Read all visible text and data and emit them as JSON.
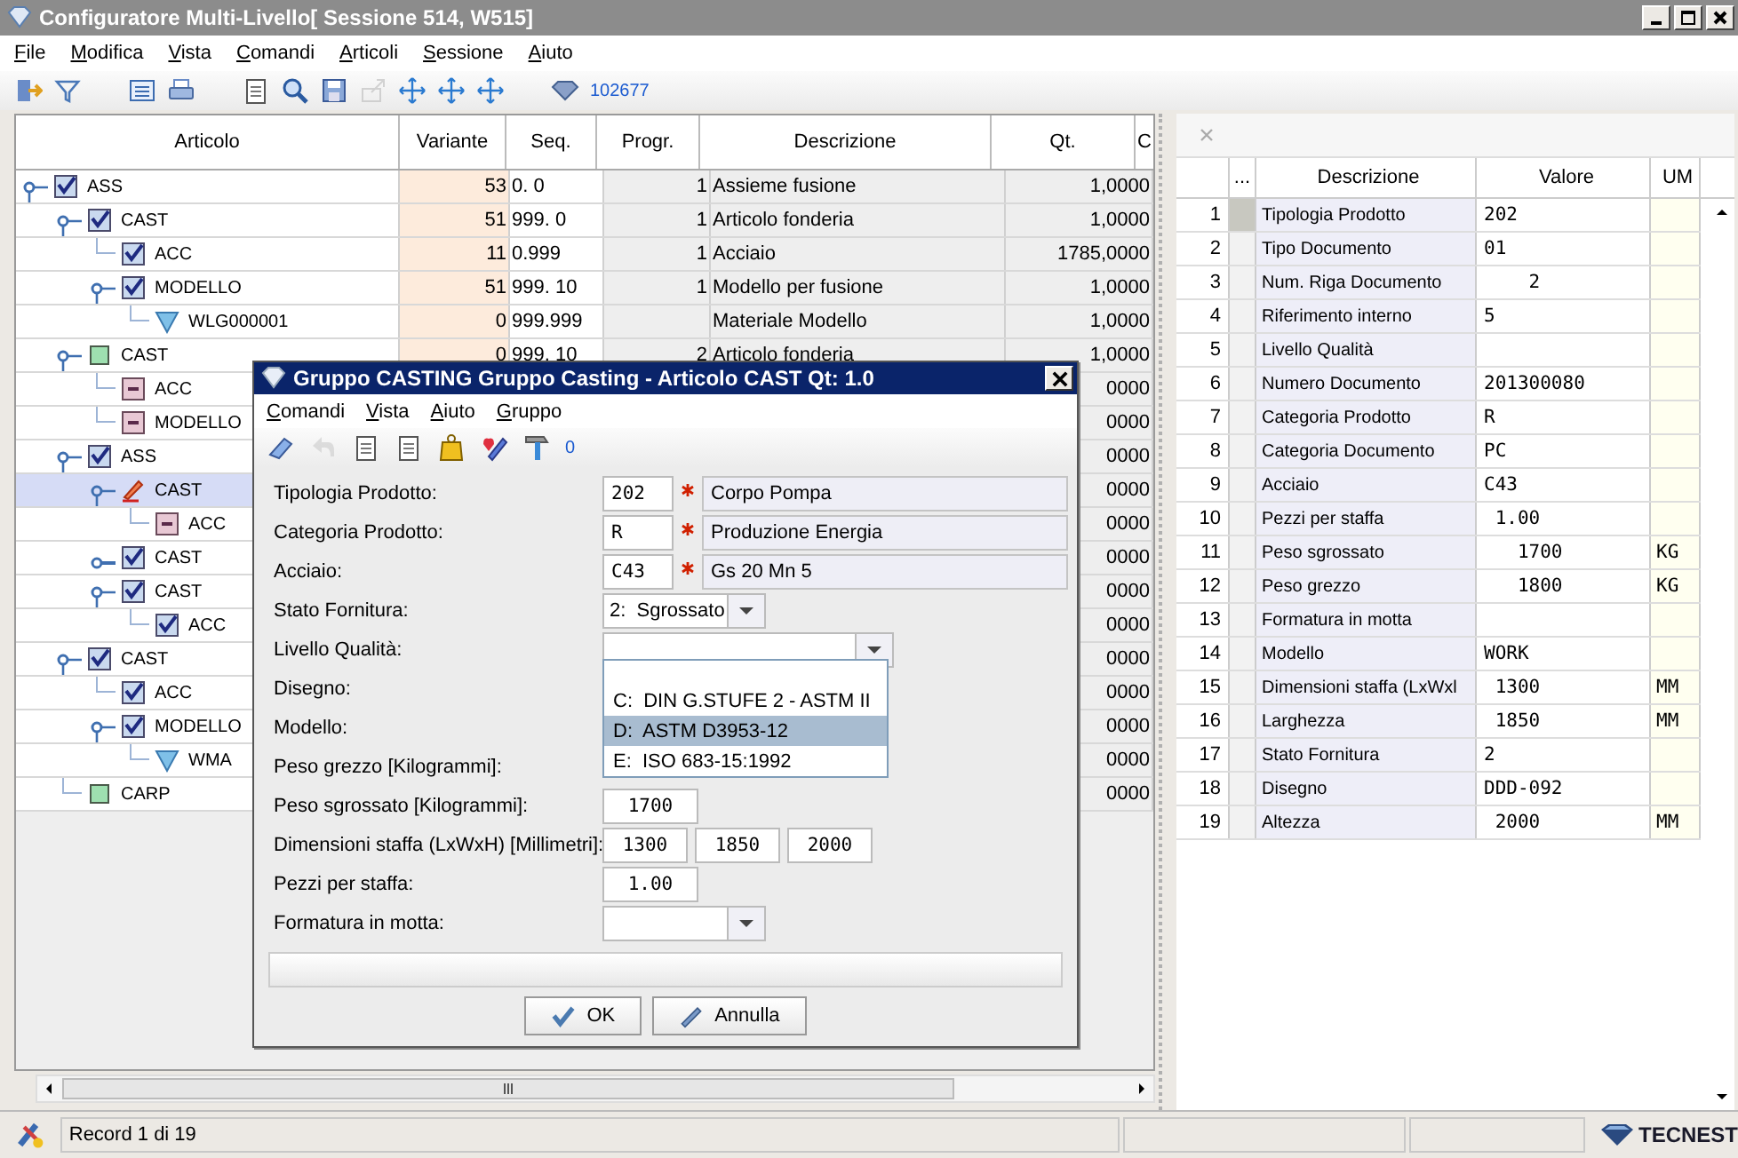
{
  "window": {
    "title": "Configuratore Multi-Livello[ Sessione 514, W515]"
  },
  "menu": [
    "File",
    "Modifica",
    "Vista",
    "Comandi",
    "Articoli",
    "Sessione",
    "Aiuto"
  ],
  "toolbar": {
    "counter": "102677"
  },
  "tree": {
    "columns": [
      "Articolo",
      "Variante",
      "Seq.",
      "Progr.",
      "Descrizione",
      "Qt.",
      "C"
    ],
    "rows": [
      {
        "label": "ASS",
        "kind": "check",
        "selected": false,
        "expanded": true,
        "variante": "53",
        "seq": "0. 0",
        "progr": "1",
        "descrizione": "Assieme fusione",
        "qt": "1,0000",
        "children": [
          {
            "label": "CAST",
            "kind": "check",
            "selected": false,
            "expanded": true,
            "variante": "51",
            "seq": "999. 0",
            "progr": "1",
            "descrizione": "Articolo fonderia",
            "qt": "1,0000",
            "children": [
              {
                "label": "ACC",
                "kind": "check",
                "selected": false,
                "variante": "11",
                "seq": "0.999",
                "progr": "1",
                "descrizione": "Acciaio",
                "qt": "1785,0000"
              },
              {
                "label": "MODELLO",
                "kind": "check",
                "selected": false,
                "expanded": true,
                "variante": "51",
                "seq": "999. 10",
                "progr": "1",
                "descrizione": "Modello per fusione",
                "qt": "1,0000",
                "children": [
                  {
                    "label": "WLG000001",
                    "kind": "material",
                    "selected": false,
                    "variante": "0",
                    "seq": "999.999",
                    "descrizione": "Materiale Modello",
                    "qt": "1,0000"
                  }
                ]
              }
            ]
          },
          {
            "label": "CAST",
            "kind": "square",
            "selected": false,
            "expanded": true,
            "variante": "0",
            "seq": "999. 10",
            "progr": "2",
            "descrizione": "Articolo fonderia",
            "qt": "1,0000",
            "children": [
              {
                "label": "ACC",
                "kind": "part",
                "selected": false,
                "qt": "0000"
              },
              {
                "label": "MODELLO",
                "kind": "part",
                "selected": false,
                "qt": "0000"
              }
            ]
          },
          {
            "label": "ASS",
            "kind": "check",
            "selected": false,
            "expanded": true,
            "qt": "0000",
            "children": [
              {
                "label": "CAST",
                "kind": "edit",
                "selected": true,
                "expanded": true,
                "qt": "0000",
                "children": [
                  {
                    "label": "ACC",
                    "kind": "part",
                    "selected": false,
                    "qt": "0000"
                  }
                ]
              },
              {
                "label": "CAST",
                "kind": "check",
                "selected": false,
                "expanded": false,
                "qt": "0000"
              },
              {
                "label": "CAST",
                "kind": "check",
                "selected": false,
                "expanded": true,
                "qt": "0000",
                "children": [
                  {
                    "label": "ACC",
                    "kind": "check",
                    "selected": false,
                    "qt": "0000"
                  }
                ]
              }
            ]
          },
          {
            "label": "CAST",
            "kind": "check",
            "selected": false,
            "expanded": true,
            "qt": "0000",
            "children": [
              {
                "label": "ACC",
                "kind": "check",
                "selected": false,
                "qt": "0000"
              },
              {
                "label": "MODELLO",
                "kind": "check",
                "selected": false,
                "expanded": true,
                "qt": "0000",
                "children": [
                  {
                    "label": "WMA",
                    "kind": "material",
                    "selected": false,
                    "qt": "0000"
                  }
                ]
              }
            ]
          },
          {
            "label": "CARP",
            "kind": "square",
            "selected": false,
            "qt": "0000"
          }
        ]
      }
    ]
  },
  "properties": {
    "columns": [
      "...",
      "Descrizione",
      "Valore",
      "UM"
    ],
    "rows": [
      {
        "n": "1",
        "descrizione": "Tipologia Prodotto",
        "valore": "202",
        "selected": true
      },
      {
        "n": "2",
        "descrizione": "Tipo Documento",
        "valore": "01",
        "selected": false
      },
      {
        "n": "3",
        "descrizione": "Num. Riga Documento",
        "valore": "    2",
        "selected": false
      },
      {
        "n": "4",
        "descrizione": "Riferimento interno",
        "valore": "5",
        "selected": false
      },
      {
        "n": "5",
        "descrizione": "Livello Qualità",
        "selected": false
      },
      {
        "n": "6",
        "descrizione": "Numero Documento",
        "valore": "201300080",
        "selected": false
      },
      {
        "n": "7",
        "descrizione": "Categoria Prodotto",
        "valore": "R",
        "selected": false
      },
      {
        "n": "8",
        "descrizione": "Categoria Documento",
        "valore": "PC",
        "selected": false
      },
      {
        "n": "9",
        "descrizione": "Acciaio",
        "valore": "C43",
        "selected": false
      },
      {
        "n": "10",
        "descrizione": "Pezzi per staffa",
        "valore": " 1.00",
        "selected": false
      },
      {
        "n": "11",
        "descrizione": "Peso sgrossato",
        "valore": "   1700",
        "um": "KG",
        "selected": false
      },
      {
        "n": "12",
        "descrizione": "Peso grezzo",
        "valore": "   1800",
        "um": "KG",
        "selected": false
      },
      {
        "n": "13",
        "descrizione": "Formatura in motta",
        "selected": false
      },
      {
        "n": "14",
        "descrizione": "Modello",
        "valore": "WORK",
        "selected": false
      },
      {
        "n": "15",
        "descrizione": "Dimensioni staffa (LxWxl",
        "valore": " 1300",
        "um": "MM",
        "selected": false
      },
      {
        "n": "16",
        "descrizione": "Larghezza",
        "valore": " 1850",
        "um": "MM",
        "selected": false
      },
      {
        "n": "17",
        "descrizione": "Stato Fornitura",
        "valore": "2",
        "selected": false
      },
      {
        "n": "18",
        "descrizione": "Disegno",
        "valore": "DDD-092",
        "selected": false
      },
      {
        "n": "19",
        "descrizione": "Altezza",
        "valore": " 2000",
        "um": "MM",
        "selected": false
      }
    ]
  },
  "dialog": {
    "title": "Gruppo CASTING Gruppo Casting - Articolo CAST Qt: 1.0",
    "menu": [
      "Comandi",
      "Vista",
      "Aiuto",
      "Gruppo"
    ],
    "toolbar_counter": "0",
    "fields": [
      {
        "label": "Tipologia Prodotto:",
        "kind": "lookup",
        "code": "202",
        "required": true,
        "description": "Corpo Pompa"
      },
      {
        "label": "Categoria Prodotto:",
        "kind": "lookup",
        "code": "R",
        "required": true,
        "description": "Produzione Energia"
      },
      {
        "label": "Acciaio:",
        "kind": "lookup",
        "code": "C43",
        "required": true,
        "description": "Gs 20 Mn 5"
      },
      {
        "label": "Stato Fornitura:",
        "kind": "combo",
        "value": "2:  Sgrossato"
      },
      {
        "label": "Livello Qualità:",
        "kind": "combo",
        "expanded": true,
        "options": [
          {
            "text": "C:  DIN G.STUFE 2 - ASTM II",
            "selected": false
          },
          {
            "text": "D:  ASTM D3953-12",
            "selected": true
          },
          {
            "text": "E:  ISO 683-15:1992",
            "selected": false
          }
        ]
      },
      {
        "label": "Disegno:"
      },
      {
        "label": "Modello:"
      },
      {
        "label": "Peso grezzo [Kilogrammi]:"
      },
      {
        "label": "Peso sgrossato [Kilogrammi]:",
        "kind": "number",
        "value": "1700"
      },
      {
        "label": "Dimensioni staffa (LxWxH) [Millimetri]:",
        "kind": "triple",
        "values": [
          "1300",
          "1850",
          "2000"
        ]
      },
      {
        "label": "Pezzi per staffa:",
        "kind": "number",
        "value": "1.00"
      },
      {
        "label": "Formatura in motta:",
        "kind": "combo"
      }
    ],
    "buttons": [
      "OK",
      "Annulla"
    ]
  },
  "status_bar": {
    "record": "Record 1 di 19",
    "brand": "TECNEST"
  }
}
